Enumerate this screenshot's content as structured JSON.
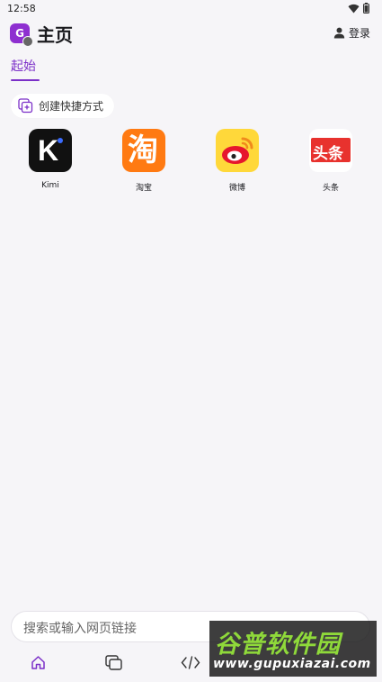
{
  "status_bar": {
    "time": "12:58"
  },
  "header": {
    "logo_letter": "G",
    "title": "主页",
    "login_label": "登录"
  },
  "tabs": [
    {
      "label": "起始",
      "active": true
    }
  ],
  "create_shortcut": {
    "label": "创建快捷方式"
  },
  "shortcuts": [
    {
      "label": "Kimi",
      "icon": "kimi-icon",
      "icon_text": "K"
    },
    {
      "label": "淘宝",
      "icon": "taobao-icon",
      "icon_text": "淘"
    },
    {
      "label": "微博",
      "icon": "weibo-icon",
      "icon_text": ""
    },
    {
      "label": "头条",
      "icon": "toutiao-icon",
      "icon_text": "头条"
    }
  ],
  "search": {
    "placeholder": "搜索或输入网页链接"
  },
  "bottom_nav": [
    {
      "icon": "home-icon"
    },
    {
      "icon": "tabs-icon"
    },
    {
      "icon": "code-icon"
    }
  ],
  "watermark": {
    "title": "谷普软件园",
    "url": "www.gupuxiazai.com"
  },
  "colors": {
    "accent": "#7b2fc8",
    "background": "#f6f5f8",
    "logo": "#8e2fd0"
  }
}
